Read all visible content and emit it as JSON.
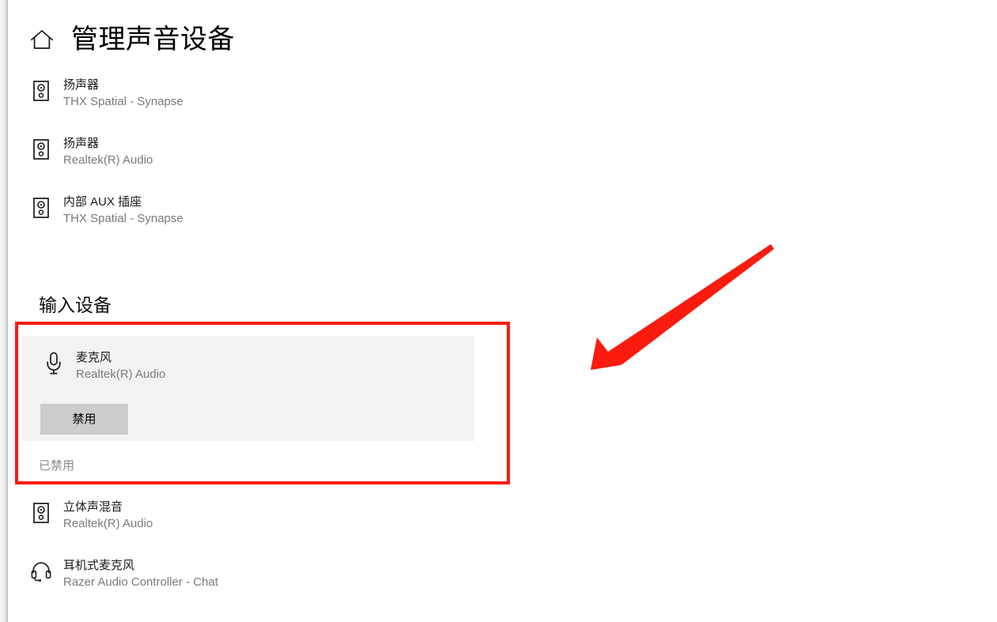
{
  "header": {
    "home_icon": "home-icon",
    "title": "管理声音设备"
  },
  "output_devices": [
    {
      "icon": "speaker-icon",
      "name": "扬声器",
      "sub": "THX Spatial - Synapse"
    },
    {
      "icon": "speaker-icon",
      "name": "扬声器",
      "sub": "Realtek(R) Audio"
    },
    {
      "icon": "speaker-icon",
      "name": "内部 AUX 插座",
      "sub": "THX Spatial - Synapse"
    }
  ],
  "input_section": {
    "heading": "输入设备",
    "selected_device": {
      "icon": "microphone-icon",
      "name": "麦克风",
      "sub": "Realtek(R) Audio",
      "action_button": "禁用",
      "status": "已禁用"
    },
    "devices": [
      {
        "icon": "speaker-icon",
        "name": "立体声混音",
        "sub": "Realtek(R) Audio"
      },
      {
        "icon": "headset-icon",
        "name": "耳机式麦克风",
        "sub": "Razer Audio Controller - Chat"
      }
    ]
  },
  "annotations": {
    "highlight_box_color": "#fc1b0f",
    "arrow_color": "#fc1b0f",
    "arrow_name": "pointer-arrow"
  },
  "colors": {
    "selected_panel_bg": "#f2f2f2",
    "button_bg": "#cccccc",
    "subtext": "#7a7a7a",
    "status_text": "#8a8a8a"
  }
}
